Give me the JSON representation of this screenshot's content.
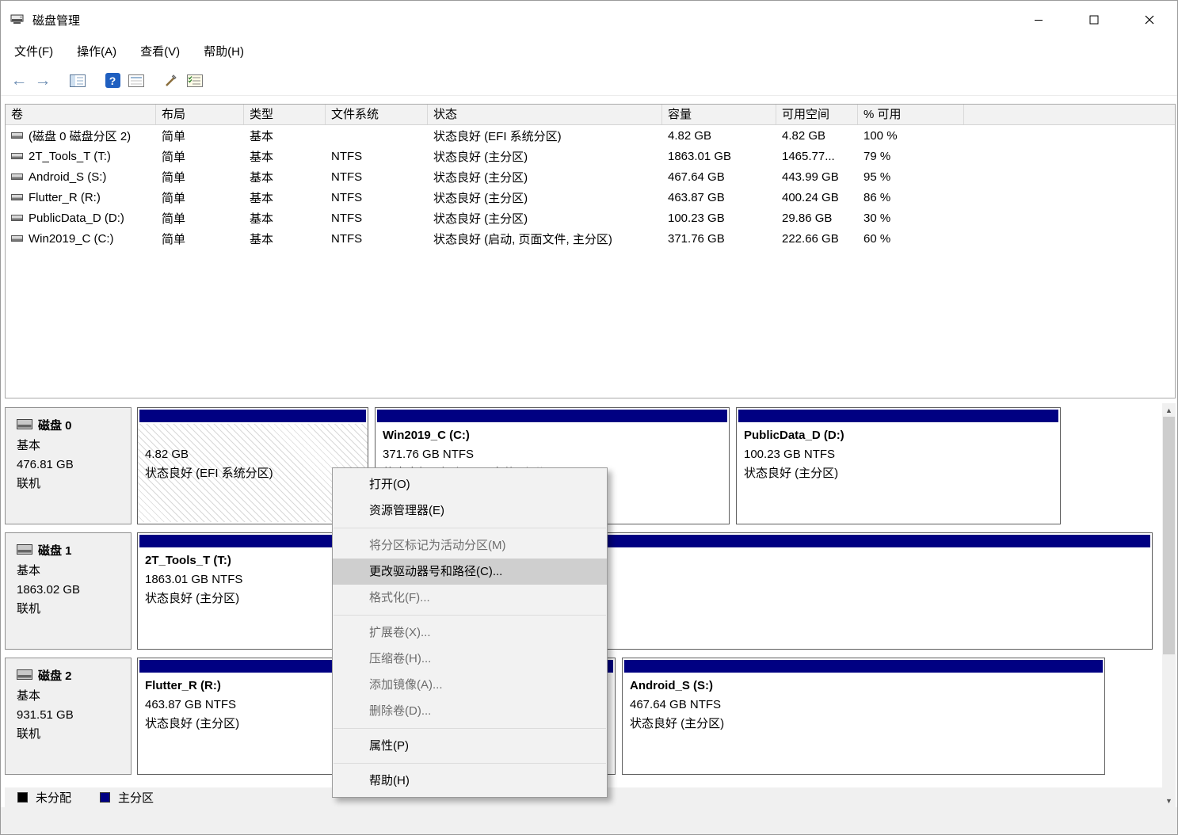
{
  "window": {
    "title": "磁盘管理"
  },
  "menubar": {
    "items": [
      "文件(F)",
      "操作(A)",
      "查看(V)",
      "帮助(H)"
    ]
  },
  "toolbar": {
    "icon_names": [
      "back-icon",
      "forward-icon",
      "console-tree-icon",
      "help-icon",
      "export-list-icon",
      "action-icon",
      "views-icon"
    ],
    "back_glyph": "←",
    "forward_glyph": "→",
    "help_glyph": "?"
  },
  "volume_list": {
    "columns": {
      "volume": "卷",
      "layout": "布局",
      "type": "类型",
      "filesystem": "文件系统",
      "status": "状态",
      "capacity": "容量",
      "free_space": "可用空间",
      "pct_free": "% 可用"
    },
    "rows": [
      {
        "volume": "(磁盘 0 磁盘分区 2)",
        "layout": "简单",
        "type": "基本",
        "fs": "",
        "status": "状态良好 (EFI 系统分区)",
        "capacity": "4.82 GB",
        "free": "4.82 GB",
        "pct": "100 %"
      },
      {
        "volume": "2T_Tools_T (T:)",
        "layout": "简单",
        "type": "基本",
        "fs": "NTFS",
        "status": "状态良好 (主分区)",
        "capacity": "1863.01 GB",
        "free": "1465.77...",
        "pct": "79 %"
      },
      {
        "volume": "Android_S (S:)",
        "layout": "简单",
        "type": "基本",
        "fs": "NTFS",
        "status": "状态良好 (主分区)",
        "capacity": "467.64 GB",
        "free": "443.99 GB",
        "pct": "95 %"
      },
      {
        "volume": "Flutter_R (R:)",
        "layout": "简单",
        "type": "基本",
        "fs": "NTFS",
        "status": "状态良好 (主分区)",
        "capacity": "463.87 GB",
        "free": "400.24 GB",
        "pct": "86 %"
      },
      {
        "volume": "PublicData_D (D:)",
        "layout": "简单",
        "type": "基本",
        "fs": "NTFS",
        "status": "状态良好 (主分区)",
        "capacity": "100.23 GB",
        "free": "29.86 GB",
        "pct": "30 %"
      },
      {
        "volume": "Win2019_C (C:)",
        "layout": "简单",
        "type": "基本",
        "fs": "NTFS",
        "status": "状态良好 (启动, 页面文件, 主分区)",
        "capacity": "371.76 GB",
        "free": "222.66 GB",
        "pct": "60 %"
      }
    ]
  },
  "graphical_view": {
    "disks": [
      {
        "name": "磁盘 0",
        "type": "基本",
        "size": "476.81 GB",
        "status": "联机",
        "partitions": [
          {
            "title": "",
            "line1": "4.82 GB",
            "line2": "状态良好 (EFI 系统分区)"
          },
          {
            "title": "Win2019_C  (C:)",
            "line1": "371.76 GB NTFS",
            "line2": "状态良好 (启动, 页面文件, 主分区)"
          },
          {
            "title": "PublicData_D  (D:)",
            "line1": "100.23 GB NTFS",
            "line2": "状态良好 (主分区)"
          }
        ]
      },
      {
        "name": "磁盘 1",
        "type": "基本",
        "size": "1863.02 GB",
        "status": "联机",
        "partitions": [
          {
            "title": "2T_Tools_T  (T:)",
            "line1": "1863.01 GB NTFS",
            "line2": "状态良好 (主分区)"
          }
        ]
      },
      {
        "name": "磁盘 2",
        "type": "基本",
        "size": "931.51 GB",
        "status": "联机",
        "partitions": [
          {
            "title": "Flutter_R  (R:)",
            "line1": "463.87 GB NTFS",
            "line2": "状态良好 (主分区)"
          },
          {
            "title": "Android_S  (S:)",
            "line1": "467.64 GB NTFS",
            "line2": "状态良好 (主分区)"
          }
        ]
      }
    ]
  },
  "legend": {
    "items": [
      {
        "label": "未分配",
        "color": "#000000"
      },
      {
        "label": "主分区",
        "color": "#000082"
      }
    ]
  },
  "context_menu": {
    "items": [
      {
        "label": "打开(O)",
        "state": "enabled"
      },
      {
        "label": "资源管理器(E)",
        "state": "enabled"
      },
      {
        "label": "将分区标记为活动分区(M)",
        "state": "disabled"
      },
      {
        "label": "更改驱动器号和路径(C)...",
        "state": "highlighted"
      },
      {
        "label": "格式化(F)...",
        "state": "disabled"
      },
      {
        "label": "扩展卷(X)...",
        "state": "disabled"
      },
      {
        "label": "压缩卷(H)...",
        "state": "disabled"
      },
      {
        "label": "添加镜像(A)...",
        "state": "disabled"
      },
      {
        "label": "删除卷(D)...",
        "state": "disabled"
      },
      {
        "label": "属性(P)",
        "state": "enabled"
      },
      {
        "label": "帮助(H)",
        "state": "enabled"
      }
    ]
  },
  "colors": {
    "primary_partition": "#000082",
    "unallocated": "#000000",
    "menu_highlight": "#cfcfcf"
  }
}
